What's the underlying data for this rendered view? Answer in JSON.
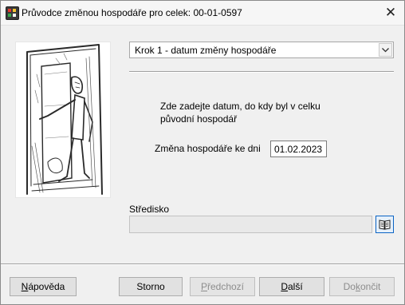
{
  "window": {
    "title": "Průvodce změnou hospodáře pro celek: 00-01-0597",
    "close_symbol": "✕",
    "app_icon": "application-grid-icon",
    "close_icon": "close-icon"
  },
  "step_selector": {
    "selected": "Krok 1 - datum změny hospodáře",
    "dropdown_icon": "chevron-down-icon"
  },
  "instructions": {
    "text": "Zde zadejte datum, do kdy byl v celku původní hospodář"
  },
  "date_field": {
    "label": "Změna hospodáře ke dni",
    "value": "01.02.2023"
  },
  "stredisko": {
    "label": "Středisko",
    "value": "",
    "lookup_icon": "book-icon"
  },
  "buttons": {
    "help": {
      "first": "N",
      "rest": "ápověda",
      "enabled": true
    },
    "cancel": {
      "label": "Storno",
      "enabled": true
    },
    "back": {
      "first": "P",
      "rest": "ředchozí",
      "enabled": false
    },
    "next": {
      "first": "D",
      "rest": "alší",
      "enabled": true
    },
    "finish": {
      "pre": "Do",
      "u": "k",
      "post": "ončit",
      "enabled": false
    }
  },
  "colors": {
    "window_bg": "#f0f0f0",
    "lookup_border": "#0b64c4",
    "disabled_text": "#8d8d8d"
  }
}
